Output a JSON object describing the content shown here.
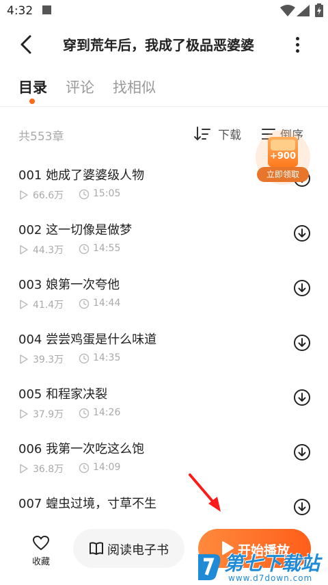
{
  "status_bar": {
    "time": "4:32"
  },
  "header": {
    "title": "穿到荒年后，我成了极品恶婆婆"
  },
  "tabs": [
    {
      "label": "目录",
      "active": true
    },
    {
      "label": "评论",
      "active": false
    },
    {
      "label": "找相似",
      "active": false
    }
  ],
  "toolbar": {
    "chapter_count": "共553章",
    "download_label": "下载",
    "sort_label": "倒序"
  },
  "reward": {
    "amount": "+900",
    "claim_label": "立即领取"
  },
  "chapters": [
    {
      "title": "001 她成了婆婆级人物",
      "plays": "66.6万",
      "duration": "15:05"
    },
    {
      "title": "002 这一切像是做梦",
      "plays": "44.3万",
      "duration": "14:55"
    },
    {
      "title": "003 娘第一次夸他",
      "plays": "41.4万",
      "duration": "14:44"
    },
    {
      "title": "004 尝尝鸡蛋是什么味道",
      "plays": "39.3万",
      "duration": "14:35"
    },
    {
      "title": "005 和程家决裂",
      "plays": "37.9万",
      "duration": "14:26"
    },
    {
      "title": "006 我第一次吃这么饱",
      "plays": "36.8万",
      "duration": "14:09"
    },
    {
      "title": "007 蝗虫过境，寸草不生",
      "plays": "",
      "duration": ""
    }
  ],
  "bottom_bar": {
    "favorite_label": "收藏",
    "read_ebook_label": "阅读电子书",
    "play_label": "开始播放"
  },
  "watermark": {
    "brand": "第七下载站",
    "url": "www.d7down.com"
  },
  "colors": {
    "accent": "#ff6a1a",
    "watermark": "#1f8ad6"
  }
}
